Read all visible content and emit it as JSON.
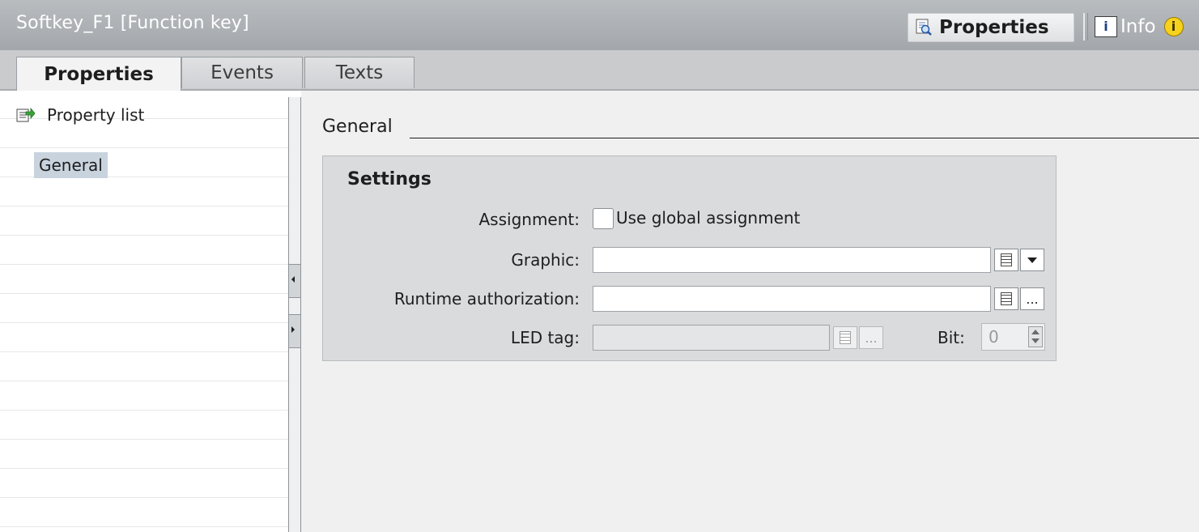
{
  "window": {
    "title": "Softkey_F1 [Function key]",
    "properties_button": "Properties",
    "info_button": "Info",
    "info_badge": "i"
  },
  "tabs": [
    {
      "label": "Properties",
      "active": true
    },
    {
      "label": "Events",
      "active": false
    },
    {
      "label": "Texts",
      "active": false
    }
  ],
  "nav": {
    "property_list": "Property list",
    "items": [
      {
        "label": "General",
        "selected": true
      }
    ]
  },
  "section": {
    "title": "General",
    "group_title": "Settings",
    "assignment": {
      "label": "Assignment:",
      "checkbox_label": "Use global assignment",
      "checked": false
    },
    "graphic": {
      "label": "Graphic:",
      "value": ""
    },
    "runtime_authorization": {
      "label": "Runtime authorization:",
      "value": "",
      "button": "..."
    },
    "led_tag": {
      "label": "LED tag:",
      "value": "",
      "button": "...",
      "enabled": false
    },
    "bit": {
      "label": "Bit:",
      "value": "0",
      "enabled": false
    }
  },
  "colors": {
    "titlebar": "#a9acaf",
    "selection": "#c8d3de",
    "info_badge": "#f6d21c"
  },
  "icons": [
    "properties-icon",
    "info-tab-icon",
    "info-badge-icon",
    "property-list-icon",
    "list-icon",
    "dropdown-arrow-icon"
  ]
}
